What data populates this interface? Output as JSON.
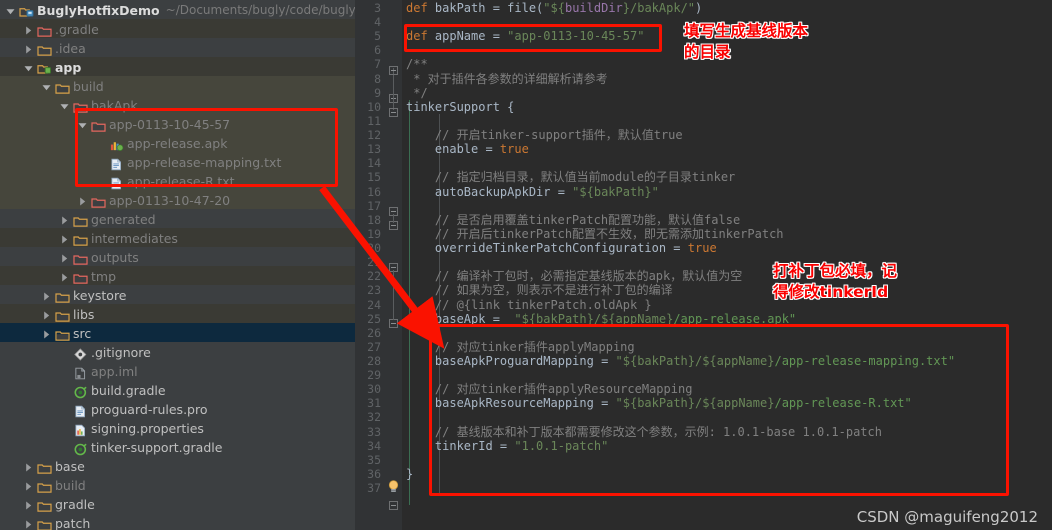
{
  "window": {
    "project_root": "BuglyHotfixDemo",
    "project_path": "~/Documents/bugly/code/bugly-",
    "watermark": "CSDN @maguifeng2012"
  },
  "tree": {
    "items": [
      {
        "label": "BuglyHotfixDemo",
        "icon": "module-icon",
        "indent": 0,
        "arrow": "down",
        "style": "bold",
        "row": "dim",
        "suffix": "~/Documents/bugly/code/bugly-"
      },
      {
        "label": ".gradle",
        "icon": "folder-red-icon",
        "indent": 1,
        "arrow": "right",
        "style": "grey",
        "row": "alt"
      },
      {
        "label": ".idea",
        "icon": "folder-icon",
        "indent": 1,
        "arrow": "right",
        "style": "grey",
        "row": "dim"
      },
      {
        "label": "app",
        "icon": "module-app-icon",
        "indent": 1,
        "arrow": "down",
        "style": "bold",
        "row": "alt"
      },
      {
        "label": "build",
        "icon": "folder-icon",
        "indent": 2,
        "arrow": "down",
        "style": "grey",
        "row": "hl"
      },
      {
        "label": "bakApk",
        "icon": "folder-red-icon",
        "indent": 3,
        "arrow": "down",
        "style": "grey",
        "row": "hl"
      },
      {
        "label": "app-0113-10-45-57",
        "icon": "folder-red-icon",
        "indent": 4,
        "arrow": "down",
        "style": "grey",
        "row": "hl"
      },
      {
        "label": "app-release.apk",
        "icon": "apk-icon",
        "indent": 5,
        "arrow": "none",
        "style": "grey",
        "row": "hl"
      },
      {
        "label": "app-release-mapping.txt",
        "icon": "txt-icon",
        "indent": 5,
        "arrow": "none",
        "style": "grey",
        "row": "hl"
      },
      {
        "label": "app-release-R.txt",
        "icon": "txt-icon",
        "indent": 5,
        "arrow": "none",
        "style": "grey",
        "row": "hl"
      },
      {
        "label": "app-0113-10-47-20",
        "icon": "folder-red-icon",
        "indent": 4,
        "arrow": "right",
        "style": "grey",
        "row": "hl"
      },
      {
        "label": "generated",
        "icon": "folder-icon",
        "indent": 3,
        "arrow": "right",
        "style": "grey",
        "row": "dim"
      },
      {
        "label": "intermediates",
        "icon": "folder-icon",
        "indent": 3,
        "arrow": "right",
        "style": "grey",
        "row": "alt"
      },
      {
        "label": "outputs",
        "icon": "folder-red-icon",
        "indent": 3,
        "arrow": "right",
        "style": "grey",
        "row": "dim"
      },
      {
        "label": "tmp",
        "icon": "folder-red-icon",
        "indent": 3,
        "arrow": "right",
        "style": "grey",
        "row": "alt"
      },
      {
        "label": "keystore",
        "icon": "folder-icon",
        "indent": 2,
        "arrow": "right",
        "style": "norm",
        "row": "dim"
      },
      {
        "label": "libs",
        "icon": "folder-icon",
        "indent": 2,
        "arrow": "right",
        "style": "norm",
        "row": "alt"
      },
      {
        "label": "src",
        "icon": "folder-icon",
        "indent": 2,
        "arrow": "right",
        "style": "norm",
        "row": "sel"
      },
      {
        "label": ".gitignore",
        "icon": "git-icon",
        "indent": 3,
        "arrow": "none",
        "style": "norm",
        "row": "dim"
      },
      {
        "label": "app.iml",
        "icon": "iml-icon",
        "indent": 3,
        "arrow": "none",
        "style": "grey",
        "row": "dim"
      },
      {
        "label": "build.gradle",
        "icon": "gradle-icon",
        "indent": 3,
        "arrow": "none",
        "style": "norm",
        "row": "dim"
      },
      {
        "label": "proguard-rules.pro",
        "icon": "txt-icon",
        "indent": 3,
        "arrow": "none",
        "style": "norm",
        "row": "dim"
      },
      {
        "label": "signing.properties",
        "icon": "properties-icon",
        "indent": 3,
        "arrow": "none",
        "style": "norm",
        "row": "dim"
      },
      {
        "label": "tinker-support.gradle",
        "icon": "gradle-icon",
        "indent": 3,
        "arrow": "none",
        "style": "norm",
        "row": "dim"
      },
      {
        "label": "base",
        "icon": "folder-icon",
        "indent": 1,
        "arrow": "right",
        "style": "norm",
        "row": "dim"
      },
      {
        "label": "build",
        "icon": "folder-icon",
        "indent": 1,
        "arrow": "right",
        "style": "grey",
        "row": "dim"
      },
      {
        "label": "gradle",
        "icon": "folder-icon",
        "indent": 1,
        "arrow": "right",
        "style": "norm",
        "row": "dim"
      },
      {
        "label": "patch",
        "icon": "folder-icon",
        "indent": 1,
        "arrow": "right",
        "style": "norm",
        "row": "dim"
      }
    ]
  },
  "editor": {
    "first_line_number": 3,
    "last_line_number": 37,
    "lines": [
      {
        "n": 3,
        "tokens": [
          {
            "t": "def ",
            "c": "kw"
          },
          {
            "t": "bakPath = file(",
            "c": "plain"
          },
          {
            "t": "\"${",
            "c": "str"
          },
          {
            "t": "buildDir",
            "c": "var"
          },
          {
            "t": "}/bakApk/\"",
            "c": "str"
          },
          {
            "t": ")",
            "c": "plain"
          }
        ]
      },
      {
        "n": 4,
        "tokens": []
      },
      {
        "n": 5,
        "tokens": [
          {
            "t": "def ",
            "c": "kw"
          },
          {
            "t": "appName = ",
            "c": "plain"
          },
          {
            "t": "\"app-0113-10-45-57\"",
            "c": "str"
          }
        ]
      },
      {
        "n": 6,
        "tokens": []
      },
      {
        "n": 7,
        "tokens": [
          {
            "t": "/**",
            "c": "cmt"
          }
        ]
      },
      {
        "n": 8,
        "tokens": [
          {
            "t": " * 对于插件各参数的详细解析请参考",
            "c": "cmt"
          }
        ]
      },
      {
        "n": 9,
        "tokens": [
          {
            "t": " */",
            "c": "cmt"
          }
        ]
      },
      {
        "n": 10,
        "tokens": [
          {
            "t": "tinkerSupport {",
            "c": "plain"
          }
        ]
      },
      {
        "n": 11,
        "tokens": []
      },
      {
        "n": 12,
        "tokens": [
          {
            "t": "    // 开启tinker-support插件，默认值true",
            "c": "cmt"
          }
        ]
      },
      {
        "n": 13,
        "tokens": [
          {
            "t": "    enable = ",
            "c": "plain"
          },
          {
            "t": "true",
            "c": "kw"
          }
        ]
      },
      {
        "n": 14,
        "tokens": []
      },
      {
        "n": 15,
        "tokens": [
          {
            "t": "    // 指定归档目录，默认值当前module的子目录tinker",
            "c": "cmt"
          }
        ]
      },
      {
        "n": 16,
        "tokens": [
          {
            "t": "    autoBackupApkDir = ",
            "c": "plain"
          },
          {
            "t": "\"${bakPath}\"",
            "c": "str"
          }
        ]
      },
      {
        "n": 17,
        "tokens": []
      },
      {
        "n": 18,
        "tokens": [
          {
            "t": "    // 是否启用覆盖tinkerPatch配置功能，默认值false",
            "c": "cmt"
          }
        ]
      },
      {
        "n": 19,
        "tokens": [
          {
            "t": "    // 开启后tinkerPatch配置不生效，即无需添加tinkerPatch",
            "c": "cmt"
          }
        ]
      },
      {
        "n": 20,
        "tokens": [
          {
            "t": "    overrideTinkerPatchConfiguration = ",
            "c": "plain"
          },
          {
            "t": "true",
            "c": "kw"
          }
        ]
      },
      {
        "n": 21,
        "tokens": []
      },
      {
        "n": 22,
        "tokens": [
          {
            "t": "    // 编译补丁包时，必需指定基线版本的apk，默认值为空",
            "c": "cmt"
          }
        ]
      },
      {
        "n": 23,
        "tokens": [
          {
            "t": "    // 如果为空，则表示不是进行补丁包的编译",
            "c": "cmt"
          }
        ]
      },
      {
        "n": 24,
        "tokens": [
          {
            "t": "    // @{link tinkerPatch.oldApk }",
            "c": "cmt"
          }
        ]
      },
      {
        "n": 25,
        "tokens": [
          {
            "t": "    baseApk =  ",
            "c": "plain"
          },
          {
            "t": "\"${bakPath}/${appName}",
            "c": "str"
          },
          {
            "t": "/app-release.apk\"",
            "c": "str2"
          }
        ]
      },
      {
        "n": 26,
        "tokens": []
      },
      {
        "n": 27,
        "tokens": [
          {
            "t": "    // 对应tinker插件applyMapping",
            "c": "cmt"
          }
        ]
      },
      {
        "n": 28,
        "tokens": [
          {
            "t": "    baseApkProguardMapping = ",
            "c": "plain"
          },
          {
            "t": "\"${bakPath}/${appName}",
            "c": "str"
          },
          {
            "t": "/app-release-mapping.txt\"",
            "c": "str2"
          }
        ]
      },
      {
        "n": 29,
        "tokens": []
      },
      {
        "n": 30,
        "tokens": [
          {
            "t": "    // 对应tinker插件applyResourceMapping",
            "c": "cmt"
          }
        ]
      },
      {
        "n": 31,
        "tokens": [
          {
            "t": "    baseApkResourceMapping = ",
            "c": "plain"
          },
          {
            "t": "\"${bakPath}/${appName}",
            "c": "str"
          },
          {
            "t": "/app-release-R.txt\"",
            "c": "str2"
          }
        ]
      },
      {
        "n": 32,
        "tokens": []
      },
      {
        "n": 33,
        "tokens": [
          {
            "t": "    // 基线版本和补丁版本都需要修改这个参数，示例: 1.0.1-base 1.0.1-patch",
            "c": "cmt"
          }
        ]
      },
      {
        "n": 34,
        "tokens": [
          {
            "t": "    tinkerId = ",
            "c": "plain"
          },
          {
            "t": "\"1.0.1-patch\"",
            "c": "str"
          }
        ]
      },
      {
        "n": 35,
        "tokens": []
      },
      {
        "n": 36,
        "tokens": [
          {
            "t": "}",
            "c": "plain"
          }
        ]
      },
      {
        "n": 37,
        "tokens": []
      }
    ]
  },
  "annotations": {
    "note_1": "填写生成基线版本\n的目录",
    "note_2": "打补丁包必填，记\n得修改tinkerId",
    "colors": {
      "highlight": "#fa1200",
      "note_text": "#fa0000",
      "note_outline": "#ffffff"
    }
  }
}
